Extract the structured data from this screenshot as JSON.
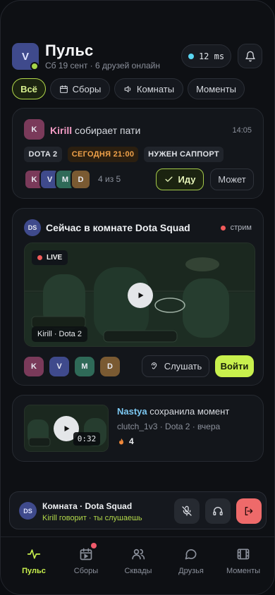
{
  "header": {
    "avatar_letter": "V",
    "title": "Пульс",
    "subtitle": "Сб 19 сент · 6 друзей онлайн",
    "ping": "12 ms",
    "ping_icon": "status-dot-icon",
    "bell_icon": "bell-icon"
  },
  "tabs": [
    {
      "label": "Всё",
      "active": true
    },
    {
      "label": "Сборы",
      "icon": "calendar-icon"
    },
    {
      "label": "Комнаты",
      "icon": "speaker-icon"
    },
    {
      "label": "Моменты"
    }
  ],
  "lobby_card": {
    "avatar": "K",
    "name": "Kirill",
    "action": "собирает пати",
    "time": "14:05",
    "tags": [
      "DOTA 2",
      "СЕГОДНЯ 21:00",
      "НУЖЕН САППОРТ"
    ],
    "members": [
      "K",
      "V",
      "M",
      "D"
    ],
    "count": "4 из 5",
    "go_label": "Иду",
    "maybe_label": "Может"
  },
  "room_card": {
    "avatar": "DS",
    "title": "Сейчас в комнате Dota Squad",
    "status": "стрим",
    "live_label": "LIVE",
    "caption": "Kirill · Dota 2",
    "members": [
      "K",
      "V",
      "M",
      "D"
    ],
    "listen_label": "Слушать",
    "join_label": "Войти"
  },
  "moment_card": {
    "name": "Nastya",
    "action": "сохранила момент",
    "meta": "clutch_1v3 · Dota 2 · вчера",
    "duration": "0:32",
    "reactions": "4"
  },
  "player": {
    "avatar": "DS",
    "title": "Комната · Dota Squad",
    "subtitle": "Kirill говорит · ты слушаешь",
    "buttons": [
      "mic-off-icon",
      "headphones-icon",
      "leave-icon"
    ]
  },
  "nav": [
    {
      "label": "Пульс",
      "icon": "pulse-icon",
      "active": true
    },
    {
      "label": "Сборы",
      "icon": "calendar-play-icon",
      "badge": true
    },
    {
      "label": "Сквады",
      "icon": "users-icon"
    },
    {
      "label": "Друзья",
      "icon": "chat-icon"
    },
    {
      "label": "Моменты",
      "icon": "film-icon"
    }
  ],
  "colors": {
    "accent": "#c8f04d",
    "kirill": "#f39cc5",
    "nastya": "#7cc8f2",
    "live": "#f05a5a",
    "tag_orange": "#f0a24a",
    "tag_orange_bg": "#2b1f10"
  }
}
